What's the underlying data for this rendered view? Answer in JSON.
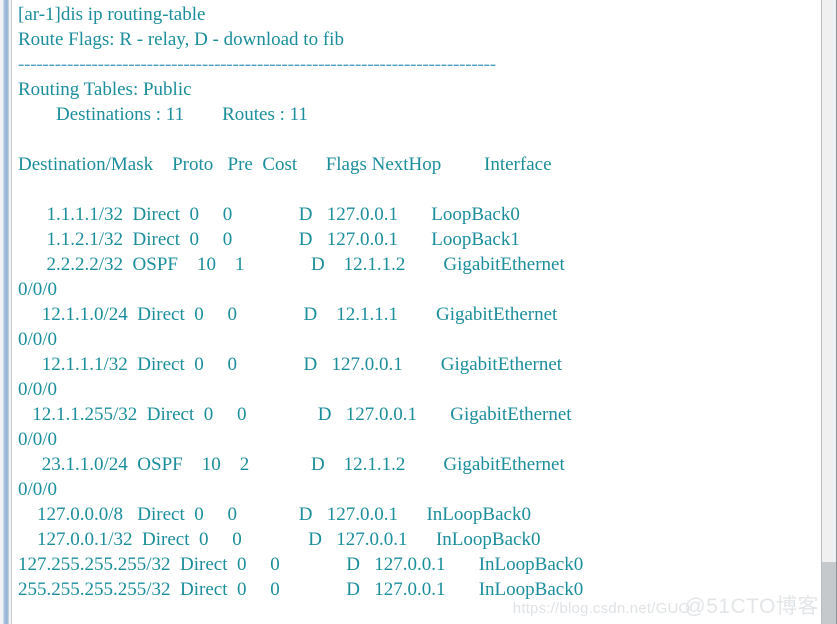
{
  "window": {
    "title": "Router CLI - display ip routing-table"
  },
  "console": {
    "prompt_line": "[ar-1]dis ip routing-table",
    "route_flags_line": "Route Flags: R - relay, D - download to fib",
    "separator": "------------------------------------------------------------------------------",
    "routing_tables_line": "Routing Tables: Public",
    "summary_line": "        Destinations : 11        Routes : 11",
    "header_line": "Destination/Mask    Proto   Pre  Cost      Flags NextHop         Interface",
    "columns": [
      "Destination/Mask",
      "Proto",
      "Pre",
      "Cost",
      "Flags",
      "NextHop",
      "Interface"
    ],
    "routes": [
      {
        "line_main": "      1.1.1.1/32  Direct  0     0              D   127.0.0.1       LoopBack0",
        "line_wrap": null,
        "destination": "1.1.1.1/32",
        "proto": "Direct",
        "pre": "0",
        "cost": "0",
        "flags": "D",
        "nexthop": "127.0.0.1",
        "interface": "LoopBack0"
      },
      {
        "line_main": "      1.1.2.1/32  Direct  0     0              D   127.0.0.1       LoopBack1",
        "line_wrap": null,
        "destination": "1.1.2.1/32",
        "proto": "Direct",
        "pre": "0",
        "cost": "0",
        "flags": "D",
        "nexthop": "127.0.0.1",
        "interface": "LoopBack1"
      },
      {
        "line_main": "      2.2.2.2/32  OSPF    10    1              D    12.1.1.2        GigabitEthernet",
        "line_wrap": "0/0/0",
        "destination": "2.2.2.2/32",
        "proto": "OSPF",
        "pre": "10",
        "cost": "1",
        "flags": "D",
        "nexthop": "12.1.1.2",
        "interface": "GigabitEthernet0/0/0"
      },
      {
        "line_main": "     12.1.1.0/24  Direct  0     0              D    12.1.1.1        GigabitEthernet",
        "line_wrap": "0/0/0",
        "destination": "12.1.1.0/24",
        "proto": "Direct",
        "pre": "0",
        "cost": "0",
        "flags": "D",
        "nexthop": "12.1.1.1",
        "interface": "GigabitEthernet0/0/0"
      },
      {
        "line_main": "     12.1.1.1/32  Direct  0     0              D   127.0.0.1        GigabitEthernet",
        "line_wrap": "0/0/0",
        "destination": "12.1.1.1/32",
        "proto": "Direct",
        "pre": "0",
        "cost": "0",
        "flags": "D",
        "nexthop": "127.0.0.1",
        "interface": "GigabitEthernet0/0/0"
      },
      {
        "line_main": "   12.1.1.255/32  Direct  0     0               D   127.0.0.1       GigabitEthernet",
        "line_wrap": "0/0/0",
        "destination": "12.1.1.255/32",
        "proto": "Direct",
        "pre": "0",
        "cost": "0",
        "flags": "D",
        "nexthop": "127.0.0.1",
        "interface": "GigabitEthernet0/0/0"
      },
      {
        "line_main": "     23.1.1.0/24  OSPF    10    2             D    12.1.1.2        GigabitEthernet",
        "line_wrap": "0/0/0",
        "destination": "23.1.1.0/24",
        "proto": "OSPF",
        "pre": "10",
        "cost": "2",
        "flags": "D",
        "nexthop": "12.1.1.2",
        "interface": "GigabitEthernet0/0/0"
      },
      {
        "line_main": "    127.0.0.0/8   Direct  0     0             D   127.0.0.1      InLoopBack0",
        "line_wrap": null,
        "destination": "127.0.0.0/8",
        "proto": "Direct",
        "pre": "0",
        "cost": "0",
        "flags": "D",
        "nexthop": "127.0.0.1",
        "interface": "InLoopBack0"
      },
      {
        "line_main": "    127.0.0.1/32  Direct  0     0              D   127.0.0.1      InLoopBack0",
        "line_wrap": null,
        "destination": "127.0.0.1/32",
        "proto": "Direct",
        "pre": "0",
        "cost": "0",
        "flags": "D",
        "nexthop": "127.0.0.1",
        "interface": "InLoopBack0"
      },
      {
        "line_main": "127.255.255.255/32  Direct  0     0              D   127.0.0.1       InLoopBack0",
        "line_wrap": null,
        "destination": "127.255.255.255/32",
        "proto": "Direct",
        "pre": "0",
        "cost": "0",
        "flags": "D",
        "nexthop": "127.0.0.1",
        "interface": "InLoopBack0"
      },
      {
        "line_main": "255.255.255.255/32  Direct  0     0              D   127.0.0.1       InLoopBack0",
        "line_wrap": null,
        "destination": "255.255.255.255/32",
        "proto": "Direct",
        "pre": "0",
        "cost": "0",
        "flags": "D",
        "nexthop": "127.0.0.1",
        "interface": "InLoopBack0"
      }
    ]
  },
  "watermark": {
    "url": "https://blog.csdn.net/GUO",
    "brand": "@51CTO博客"
  },
  "colors": {
    "text": "#1b8e9c",
    "separator": "#4d9fc0",
    "background": "#ffffff",
    "scrollbar": "#8fb0d2",
    "watermark": "#dfe3e6"
  }
}
